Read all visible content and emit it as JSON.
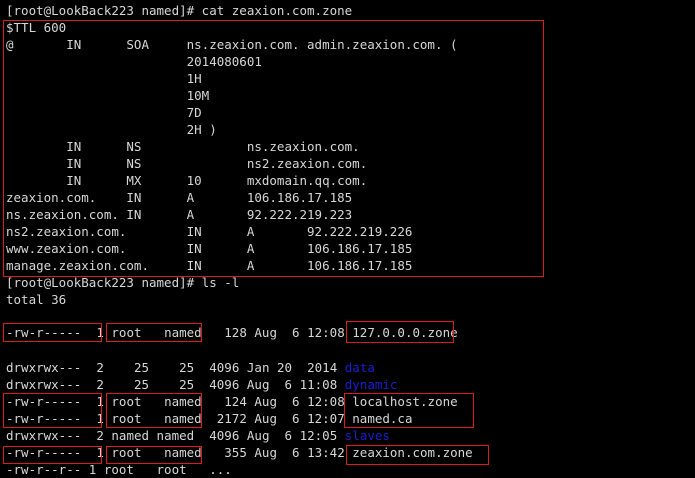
{
  "terminal": {
    "prompt1": "[root@LookBack223 named]# cat zeaxion.com.zone",
    "zone": [
      "$TTL 600",
      "@       IN      SOA     ns.zeaxion.com. admin.zeaxion.com. (",
      "                        2014080601",
      "                        1H",
      "                        10M",
      "                        7D",
      "                        2H )",
      "        IN      NS              ns.zeaxion.com.",
      "        IN      NS              ns2.zeaxion.com.",
      "        IN      MX      10      mxdomain.qq.com.",
      "zeaxion.com.    IN      A       106.186.17.185",
      "ns.zeaxion.com. IN      A       92.222.219.223",
      "ns2.zeaxion.com.        IN      A       92.222.219.226",
      "www.zeaxion.com.        IN      A       106.186.17.185",
      "manage.zeaxion.com.     IN      A       106.186.17.185"
    ],
    "prompt2": "[root@LookBack223 named]# ls -l",
    "total": "total 36",
    "listing": [
      {
        "perms": "-rw-r-----",
        "links": " 1",
        "owner": "root  ",
        "group": " named",
        "size": "  128",
        "month": "Aug",
        "day": " 6",
        "time": "12:08",
        "name": "127.0.0.0.zone",
        "is_dir": false
      },
      {
        "perms": "drwxrwx---",
        "links": " 2",
        "owner": "   25 ",
        "group": "   25",
        "size": " 4096",
        "month": "Jan",
        "day": "20",
        "time": " 2014",
        "name": "data",
        "is_dir": true
      },
      {
        "perms": "drwxrwx---",
        "links": " 2",
        "owner": "   25 ",
        "group": "   25",
        "size": " 4096",
        "month": "Aug",
        "day": " 6",
        "time": "11:08",
        "name": "dynamic",
        "is_dir": true
      },
      {
        "perms": "-rw-r-----",
        "links": " 1",
        "owner": "root  ",
        "group": " named",
        "size": "  124",
        "month": "Aug",
        "day": " 6",
        "time": "12:08",
        "name": "localhost.zone",
        "is_dir": false
      },
      {
        "perms": "-rw-r-----",
        "links": " 1",
        "owner": "root  ",
        "group": " named",
        "size": " 2172",
        "month": "Aug",
        "day": " 6",
        "time": "12:07",
        "name": "named.ca",
        "is_dir": false
      },
      {
        "perms": "drwxrwx---",
        "links": " 2",
        "owner": "named ",
        "group": "named",
        "size": " 4096",
        "month": "Aug",
        "day": " 6",
        "time": "12:05",
        "name": "slaves",
        "is_dir": true
      },
      {
        "perms": "-rw-r-----",
        "links": " 1",
        "owner": "root  ",
        "group": " named",
        "size": "  355",
        "month": "Aug",
        "day": " 6",
        "time": "13:42",
        "name": "zeaxion.com.zone",
        "is_dir": false
      }
    ],
    "partial_last_line": "-rw-r--r-- 1 root   root   ..."
  },
  "colors": {
    "background": "#000000",
    "text": "#d6d6d6",
    "directory": "#1b1bd8",
    "highlight_box": "#e01818"
  }
}
